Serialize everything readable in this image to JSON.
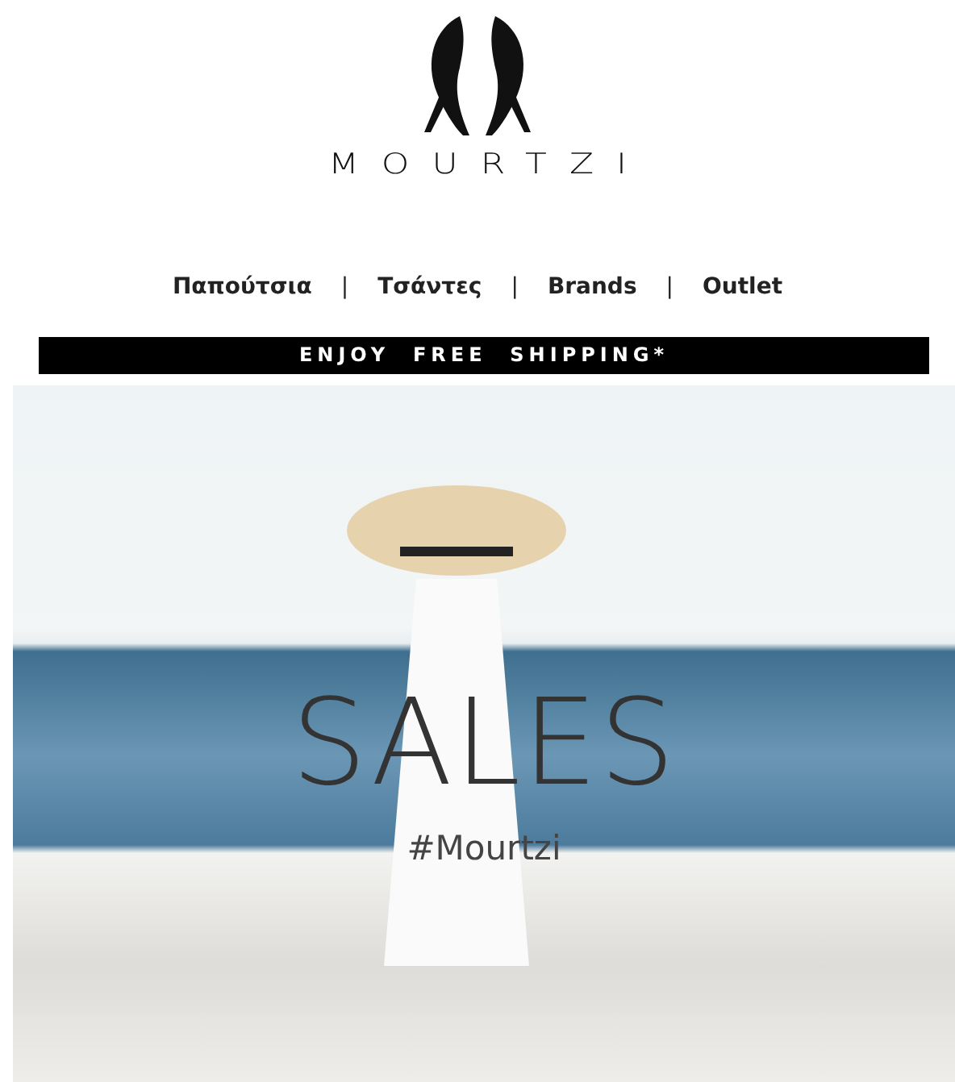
{
  "logo": {
    "wordmark": "MOURTZI"
  },
  "nav": {
    "items": [
      {
        "label": "Παπούτσια"
      },
      {
        "label": "Τσάντες"
      },
      {
        "label": "Brands"
      },
      {
        "label": "Outlet"
      }
    ],
    "separator": "|"
  },
  "banner": {
    "text": "ENJOY  FREE  SHIPPING*"
  },
  "hero": {
    "title": "SALES",
    "hashtag": "#Mourtzi"
  }
}
